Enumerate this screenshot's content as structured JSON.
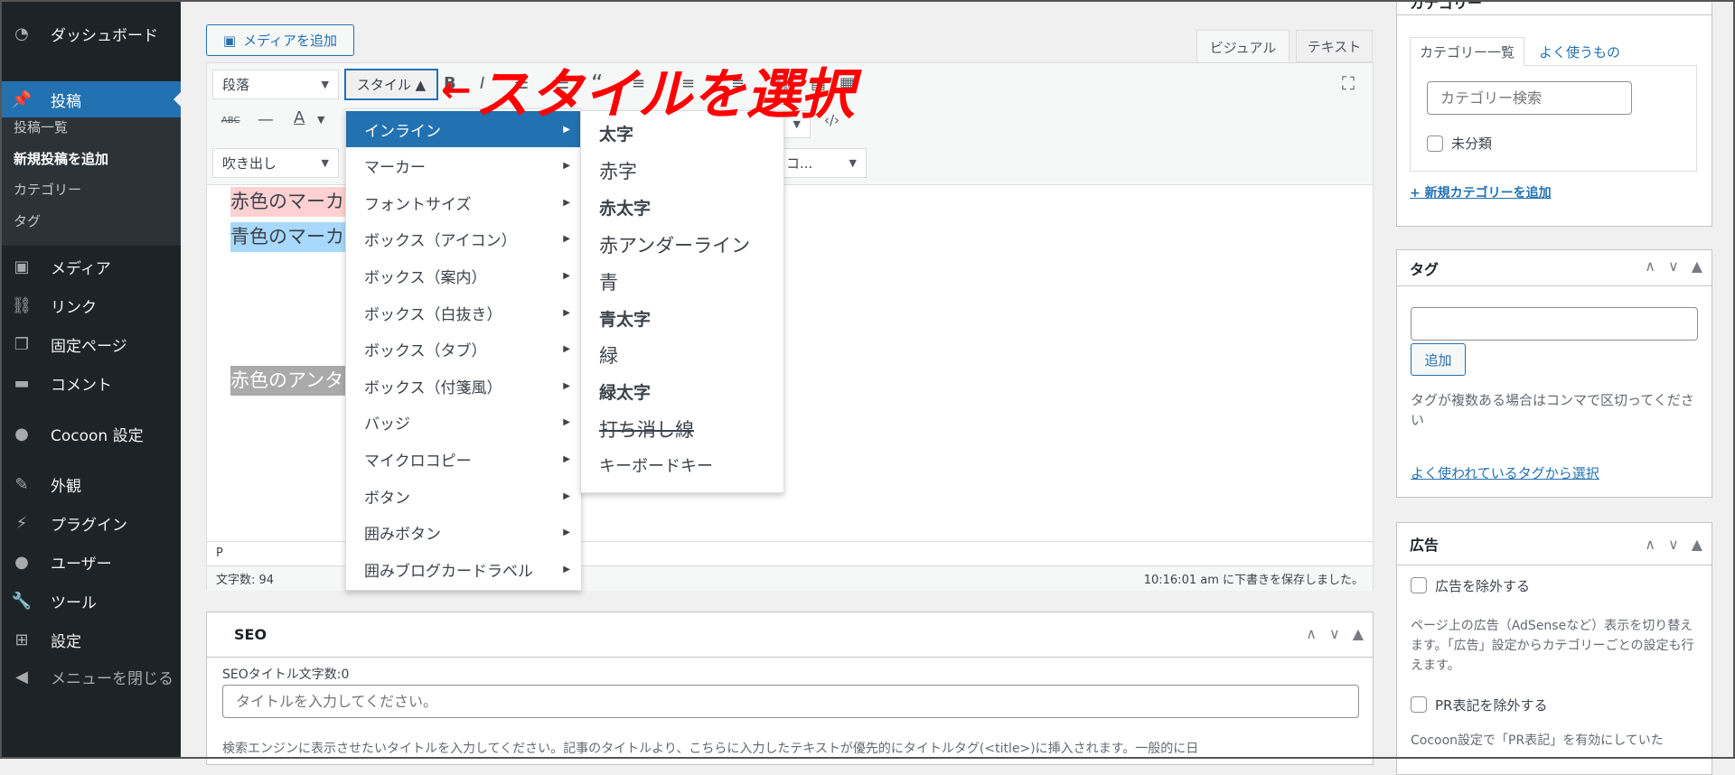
{
  "sidebar": {
    "items": [
      {
        "label": "ダッシュボード",
        "icon": "dashboard-icon"
      },
      {
        "label": "投稿",
        "icon": "pin-icon",
        "active": true
      },
      {
        "label": "メディア",
        "icon": "media-icon"
      },
      {
        "label": "リンク",
        "icon": "link-icon"
      },
      {
        "label": "固定ページ",
        "icon": "pages-icon"
      },
      {
        "label": "コメント",
        "icon": "comment-icon"
      },
      {
        "label": "Cocoon 設定",
        "icon": "cocoon-icon"
      },
      {
        "label": "外観",
        "icon": "appearance-icon"
      },
      {
        "label": "プラグイン",
        "icon": "plugin-icon"
      },
      {
        "label": "ユーザー",
        "icon": "user-icon"
      },
      {
        "label": "ツール",
        "icon": "tools-icon"
      },
      {
        "label": "設定",
        "icon": "settings-icon"
      },
      {
        "label": "メニューを閉じる",
        "icon": "collapse-icon"
      }
    ],
    "submenu": [
      "投稿一覧",
      "新規投稿を追加",
      "カテゴリー",
      "タグ"
    ],
    "submenu_current": 1
  },
  "editor": {
    "add_media": "メディアを追加",
    "tab_visual": "ビジュアル",
    "tab_text": "テキスト",
    "format_select": "段落",
    "style_button": "スタイル ▲",
    "balloon_select": "吹き出し",
    "shortcode_select": "ートコ...",
    "lines": [
      "赤色のマーカ",
      "青色のマーカ",
      "赤色のアンタ"
    ],
    "path": "P",
    "word_count": "文字数: 94",
    "save_status": "10:16:01 am に下書きを保存しました。"
  },
  "style_menu": {
    "items": [
      "インライン",
      "マーカー",
      "フォントサイズ",
      "ボックス（アイコン）",
      "ボックス（案内）",
      "ボックス（白抜き）",
      "ボックス（タブ）",
      "ボックス（付箋風）",
      "バッジ",
      "マイクロコピー",
      "ボタン",
      "囲みボタン",
      "囲みブログカードラベル"
    ],
    "highlighted": 0
  },
  "inline_menu": {
    "items": [
      {
        "label": "太字",
        "style": "bold"
      },
      {
        "label": "赤字",
        "style": "normal"
      },
      {
        "label": "赤太字",
        "style": "bold"
      },
      {
        "label": "赤アンダーライン",
        "style": "normal"
      },
      {
        "label": "青",
        "style": "normal"
      },
      {
        "label": "青太字",
        "style": "bold"
      },
      {
        "label": "緑",
        "style": "normal"
      },
      {
        "label": "緑太字",
        "style": "bold"
      },
      {
        "label": "打ち消し線",
        "style": "strike"
      },
      {
        "label": "キーボードキー",
        "style": "small"
      }
    ]
  },
  "annotation": {
    "text": "スタイルを選択",
    "arrow": "←",
    "color": "#ff0000"
  },
  "seo": {
    "title": "SEO",
    "count_label": "SEOタイトル文字数:0",
    "placeholder": "タイトルを入力してください。",
    "help": "検索エンジンに表示させたいタイトルを入力してください。記事のタイトルより、こちらに入力したテキストが優先的にタイトルタグ(<title>)に挿入されます。一般的に日"
  },
  "category": {
    "title": "カテゴリー",
    "tab_all": "カテゴリー一覧",
    "tab_popular": "よく使うもの",
    "search_placeholder": "カテゴリー検索",
    "items": [
      "未分類"
    ],
    "add_link": "+ 新規カテゴリーを追加"
  },
  "tags": {
    "title": "タグ",
    "add_button": "追加",
    "help": "タグが複数ある場合はコンマで区切ってください",
    "choose_link": "よく使われているタグから選択"
  },
  "ads": {
    "title": "広告",
    "exclude_label": "広告を除外する",
    "help": "ページ上の広告（AdSenseなど）表示を切り替えます。「広告」設定からカテゴリーごとの設定も行えます。",
    "pr_label": "PR表記を除外する",
    "pr_help": "Cocoon設定で「PR表記」を有効にしていた"
  },
  "colors": {
    "accent": "#2271b1",
    "sidebar": "#1d2327",
    "marker_red": "#ffd0d1",
    "marker_blue": "#a8d8fb",
    "underline_gray": "#aaaaaa"
  }
}
